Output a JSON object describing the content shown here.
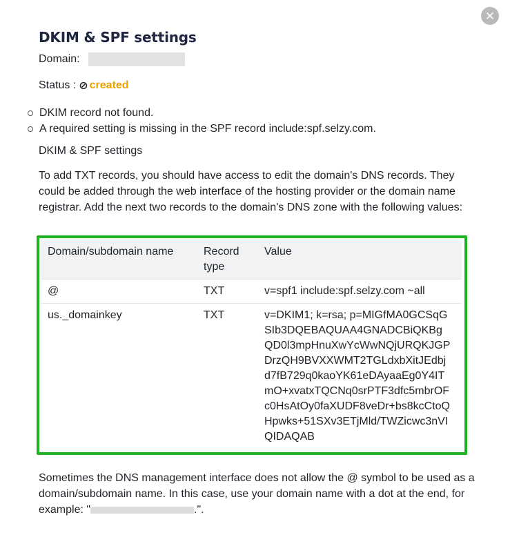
{
  "modal": {
    "title": "DKIM & SPF settings",
    "close_icon": "close-icon",
    "close_glyph": "✕"
  },
  "domain": {
    "label": "Domain:",
    "value_masked": true
  },
  "status": {
    "label": "Status :",
    "icon": "status-blocked-icon",
    "icon_glyph": "⊘",
    "value": "created",
    "value_color": "#f0a100"
  },
  "issues": [
    "DKIM record not found.",
    "A required setting is missing in the SPF record include:spf.selzy.com."
  ],
  "section_label": "DKIM & SPF settings",
  "instructions": "To add TXT records, you should have access to edit the domain's DNS records. They could be added through the web interface of the hosting provider or the domain name registrar. Add the next two records to the domain's DNS zone with the following values:",
  "table": {
    "headers": [
      "Domain/subdomain name",
      "Record type",
      "Value"
    ],
    "rows": [
      {
        "name": "@",
        "type": "TXT",
        "value": "v=spf1 include:spf.selzy.com ~all"
      },
      {
        "name": "us._domainkey",
        "type": "TXT",
        "value": "v=DKIM1; k=rsa; p=MIGfMA0GCSqGSIb3DQEBAQUAA4GNADCBiQKBgQD0l3mpHnuXwYcWwNQjURQKJGPDrzQH9BVXXWMT2TGLdxbXitJEdbjd7fB729q0kaoYK61eDAyaaEg0Y4ITmO+xvatxTQCNq0srPTF3dfc5mbrOFc0HsAtOy0faXUDF8veDr+bs8kcCtoQHpwks+51SXv3ETjMld/TWZicwc3nVIQIDAQAB"
      }
    ],
    "highlight_color": "#1fb320"
  },
  "footer": {
    "text_before": "Sometimes the DNS management interface does not allow the @ symbol to be used as a domain/subdomain name. In this case, use your domain name with a dot at the end, for example: \"",
    "text_after": ".\"."
  }
}
